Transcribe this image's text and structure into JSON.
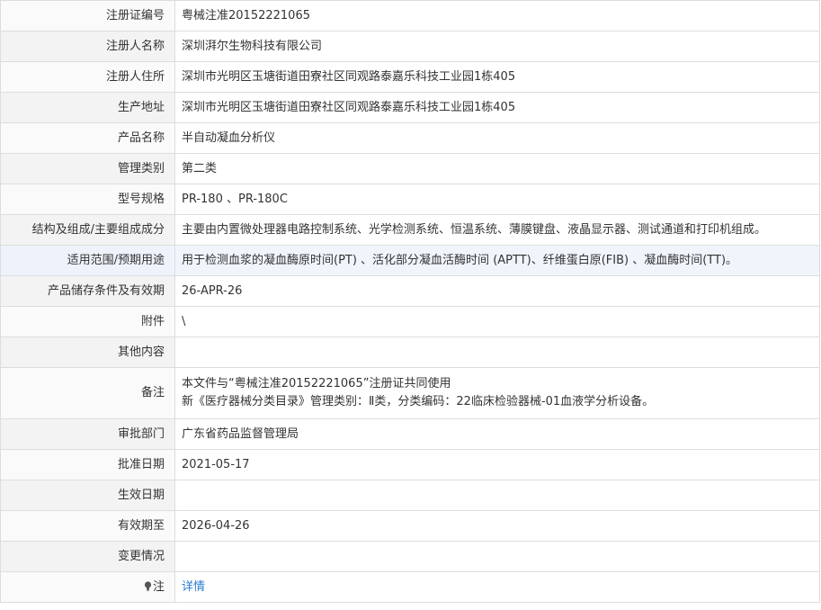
{
  "rows": [
    {
      "label": "注册证编号",
      "value": "粤械注准20152221065"
    },
    {
      "label": "注册人名称",
      "value": "深圳湃尔生物科技有限公司"
    },
    {
      "label": "注册人住所",
      "value": "深圳市光明区玉塘街道田寮社区同观路泰嘉乐科技工业园1栋405"
    },
    {
      "label": "生产地址",
      "value": "深圳市光明区玉塘街道田寮社区同观路泰嘉乐科技工业园1栋405"
    },
    {
      "label": "产品名称",
      "value": "半自动凝血分析仪"
    },
    {
      "label": "管理类别",
      "value": "第二类"
    },
    {
      "label": "型号规格",
      "value": "PR-180 、PR-180C"
    },
    {
      "label": "结构及组成/主要组成成分",
      "value": "主要由内置微处理器电路控制系统、光学检测系统、恒温系统、薄膜键盘、液晶显示器、测试通道和打印机组成。"
    },
    {
      "label": "适用范围/预期用途",
      "value": "用于检测血浆的凝血酶原时间(PT) 、活化部分凝血活酶时间 (APTT)、纤维蛋白原(FIB) 、凝血酶时间(TT)。"
    },
    {
      "label": "产品储存条件及有效期",
      "value": "26-APR-26"
    },
    {
      "label": "附件",
      "value": "\\"
    },
    {
      "label": "其他内容",
      "value": ""
    },
    {
      "label": "备注",
      "value_lines": [
        "本文件与“粤械注准20152221065”注册证共同使用",
        "新《医疗器械分类目录》管理类别：Ⅱ类，分类编码：22临床检验器械-01血液学分析设备。"
      ]
    },
    {
      "label": "审批部门",
      "value": "广东省药品监督管理局"
    },
    {
      "label": "批准日期",
      "value": "2021-05-17"
    },
    {
      "label": "生效日期",
      "value": ""
    },
    {
      "label": "有效期至",
      "value": "2026-04-26"
    },
    {
      "label": "变更情况",
      "value": ""
    },
    {
      "label": "注",
      "value": "详情",
      "icon": "lightbulb-icon"
    }
  ],
  "colors": {
    "link": "#2a7ccf",
    "border": "#dddddd",
    "highlight_row": "#f0f5fc"
  }
}
